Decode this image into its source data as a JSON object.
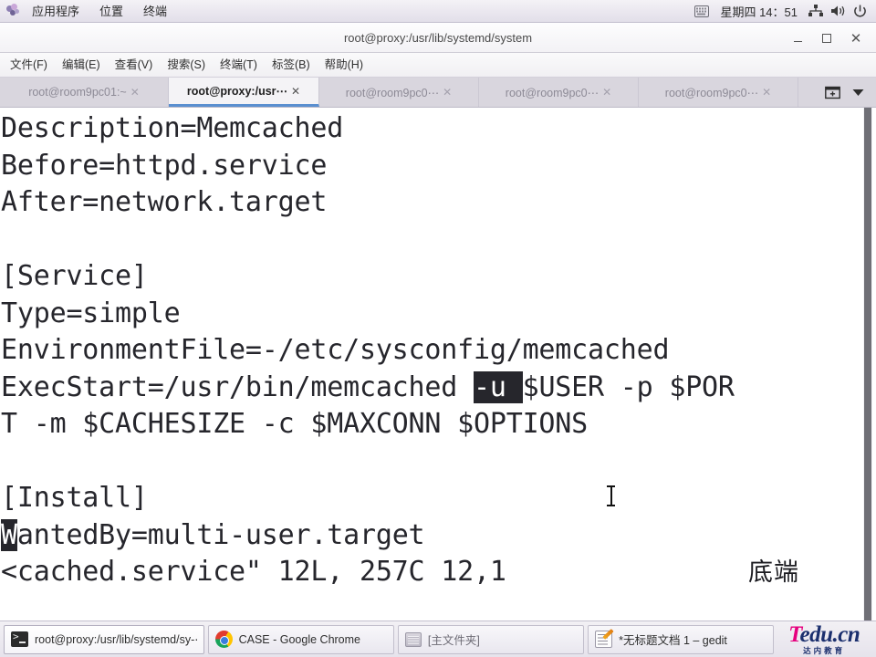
{
  "top_panel": {
    "logo_icon": "gnome-foot-icon",
    "menus": [
      "应用程序",
      "位置",
      "终端"
    ],
    "clock": "星期四 14：51",
    "tray": [
      {
        "name": "keyboard-indicator-icon"
      },
      {
        "name": "network-icon"
      },
      {
        "name": "volume-icon"
      },
      {
        "name": "power-icon"
      }
    ]
  },
  "window": {
    "title": "root@proxy:/usr/lib/systemd/system",
    "buttons": {
      "minimize": "_",
      "maximize": "□",
      "close": "✕"
    },
    "menubar": [
      "文件(F)",
      "编辑(E)",
      "查看(V)",
      "搜索(S)",
      "终端(T)",
      "标签(B)",
      "帮助(H)"
    ],
    "tabs": [
      {
        "label": "root@room9pc01:~",
        "active": false,
        "close": "✕"
      },
      {
        "label": "root@proxy:/usr⋯",
        "active": true,
        "close": "✕"
      },
      {
        "label": "root@room9pc0⋯",
        "active": false,
        "close": "✕"
      },
      {
        "label": "root@room9pc0⋯",
        "active": false,
        "close": "✕"
      },
      {
        "label": "root@room9pc0⋯",
        "active": false,
        "close": "✕"
      }
    ],
    "tabbar_buttons": [
      {
        "name": "new-tab-icon",
        "glyph": "⊞"
      },
      {
        "name": "tab-list-chevron-down-icon",
        "glyph": "▼"
      }
    ]
  },
  "terminal": {
    "lines": {
      "l1": "Description=Memcached",
      "l2": "Before=httpd.service",
      "l3": "After=network.target",
      "l4": "",
      "l5": "[Service]",
      "l6": "Type=simple",
      "l7": "EnvironmentFile=-/etc/sysconfig/memcached",
      "l8_before": "ExecStart=/usr/bin/memcached ",
      "l8_highlight": "-u ",
      "l8_after": "$USER -p $POR",
      "l9": "T -m $CACHESIZE -c $MAXCONN $OPTIONS",
      "l10": "",
      "l11": "[Install]",
      "l12_cursor": "W",
      "l12_rest": "antedBy=multi-user.target",
      "l13": "<cached.service\" 12L, 257C 12,1",
      "l13_right": "底端"
    },
    "colors": {
      "background": "#ffffff",
      "foreground": "#26262c",
      "highlight_bg": "#26262c",
      "highlight_fg": "#ffffff"
    }
  },
  "taskbar": {
    "items": [
      {
        "label": "root@proxy:/usr/lib/systemd/sy-⋯",
        "icon": "terminal-icon",
        "active": true
      },
      {
        "label": "CASE - Google Chrome",
        "icon": "chrome-icon",
        "active": false
      },
      {
        "label": "[主文件夹]",
        "icon": "folder-icon",
        "active": false
      },
      {
        "label": "*无标题文档 1 – gedit",
        "icon": "gedit-icon",
        "active": false
      }
    ],
    "brand": {
      "t": "T",
      "rest": "edu.cn",
      "sub": "达内教育",
      "color_t": "#e6007e",
      "color_rest": "#1b2f6e"
    }
  }
}
